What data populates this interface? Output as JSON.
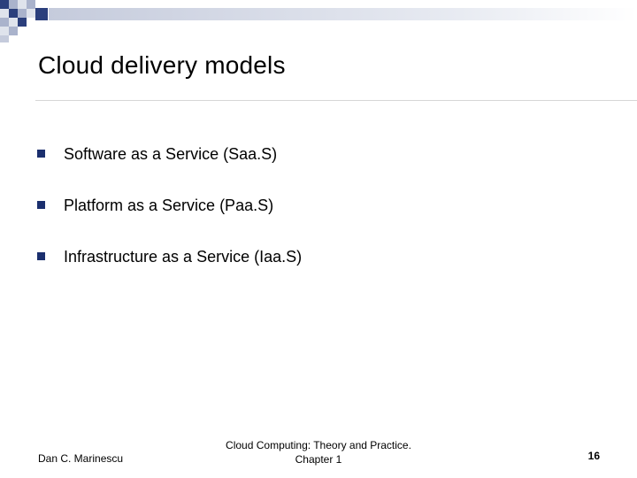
{
  "slide": {
    "title": "Cloud delivery models",
    "bullets": [
      "Software as a Service (Saa.S)",
      "Platform as a Service (Paa.S)",
      "Infrastructure as a Service (Iaa.S)"
    ]
  },
  "footer": {
    "author": "Dan C. Marinescu",
    "book_line1": "Cloud Computing: Theory and Practice.",
    "book_line2": "Chapter 1",
    "page_number": "16"
  },
  "colors": {
    "bullet": "#1b2f6e",
    "band_dark": "#2b3f7c",
    "band_light": "#bcc3d6"
  }
}
